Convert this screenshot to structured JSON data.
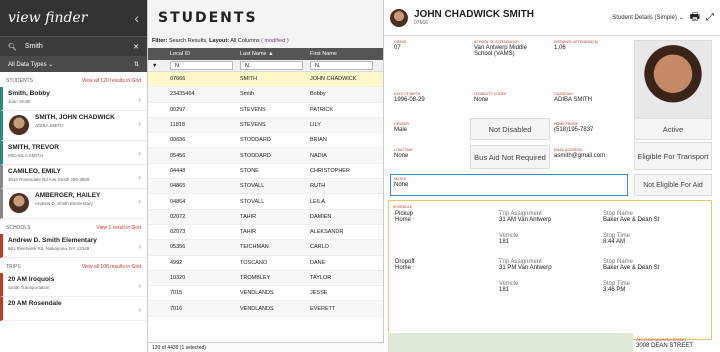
{
  "left": {
    "logo": "view finder",
    "search_value": "Smith",
    "filter_label": "All Data Types",
    "students_header": "STUDENTS",
    "students_link": "View all 120 results in Grid",
    "students": [
      {
        "name": "Smith, Bobby",
        "sub": "Joan Smith"
      },
      {
        "name": "SMITH, JOHN CHADWICK",
        "sub": "ADIBA SMITH"
      },
      {
        "name": "SMITH, TREVOR",
        "sub": "MICAELA SMITH"
      },
      {
        "name": "CAMILEO, EMILY",
        "sub": "3010 Rosendale Rd Ave Smith 280-3609"
      },
      {
        "name": "AMBERGER, HAILEY",
        "sub": "Andrew D. Smith Elementary"
      }
    ],
    "schools_header": "SCHOOLS",
    "schools_link": "View 1 result in Grid",
    "schools": [
      {
        "name": "Andrew D. Smith Elementary",
        "sub": "961 Riverview Rd, Niskayuna, NY 12348"
      }
    ],
    "trips_header": "TRIPS",
    "trips_link": "View all 108 results in Grid",
    "trips": [
      {
        "name": "20 AM Iroquois",
        "sub": "Smith Transportation"
      },
      {
        "name": "20 AM Rosendale",
        "sub": ""
      }
    ]
  },
  "mid": {
    "title": "STUDENTS",
    "filter_prefix": "Filter:",
    "filter_value": "Search Results,",
    "layout_prefix": "Layout:",
    "layout_value": "All Columns",
    "modified": "( modified )",
    "columns": [
      "Local ID",
      "Last Name",
      "First Name"
    ],
    "filter_chip": "N.",
    "rows": [
      [
        "07666",
        "SMITH",
        "JOHN CHADWICK"
      ],
      [
        "23435464",
        "Smith",
        "Bobby"
      ],
      [
        "00297",
        "STEVENS",
        "PATRICK"
      ],
      [
        "11818",
        "STEVENS",
        "LILY"
      ],
      [
        "00636",
        "STODDARD",
        "BRIAN"
      ],
      [
        "05456",
        "STODDARD",
        "NADIA"
      ],
      [
        "04448",
        "STONE",
        "CHRISTOPHER"
      ],
      [
        "04865",
        "STOVALL",
        "RUTH"
      ],
      [
        "04864",
        "STOVALL",
        "LEILA"
      ],
      [
        "02072",
        "TAHIR",
        "DAMIEN"
      ],
      [
        "02073",
        "TAHIR",
        "ALEKSANDR"
      ],
      [
        "05356",
        "TEICHMAN",
        "CARLO"
      ],
      [
        "4992",
        "TOSCANO",
        "DANE"
      ],
      [
        "10320",
        "TROMBLEY",
        "TAYLOR"
      ],
      [
        "7015",
        "VENDLANDS",
        "JESSE"
      ],
      [
        "7016",
        "VENDLANDS",
        "EVERETT"
      ]
    ],
    "footer": "120 of 4439 (1 selected)"
  },
  "right": {
    "name": "JOHN CHADWICK SMITH",
    "id": "07666",
    "view_label": "Student Details (Simple)",
    "fields": {
      "grade_label": "GRADE",
      "grade": "07",
      "school_label": "SCHOOL OF ATTENDANCE",
      "school": "Van Antwerp Middle School (VAMS)",
      "distance_label": "DISTANCE (ATTENDANCE)",
      "distance": "1.06",
      "dob_label": "DATE OF BIRTH",
      "dob": "1996-08-29",
      "disability_label": "DISABILITY CODES",
      "disability": "None",
      "guardian_label": "GUARDIAN",
      "guardian": "ADIBA SMITH",
      "gender_label": "GENDER",
      "gender": "Male",
      "phone_label": "HOME PHONE",
      "phone": "(518)195-7837",
      "load_label": "LOAD TIME",
      "load": "None",
      "email_label": "EMAIL ADDRESS",
      "email": "asmith@gmail.com",
      "notes_label": "NOTES",
      "notes": "None"
    },
    "badges": {
      "not_disabled": "Not Disabled",
      "active": "Active",
      "bus_aid": "Bus Aid Not Required",
      "eligible": "Eligible For Transport",
      "not_eligible": "Not Eligible For Aid"
    },
    "schedule": {
      "label": "SCHEDULE",
      "pickup": {
        "type": "Pickup",
        "from": "Home",
        "trip_label": "Trip Assignment",
        "trip": "31 AM Van Antwerp",
        "vehicle_label": "Vehicle",
        "vehicle": "181",
        "stop_label": "Stop Name",
        "stop": "Baker Ave & Dean St",
        "time_label": "Stop Time",
        "time": "8:44 AM"
      },
      "dropoff": {
        "type": "Dropoff",
        "from": "Home",
        "trip_label": "Trip Assignment",
        "trip": "31 PM Van Antwerp",
        "vehicle_label": "Vehicle",
        "vehicle": "181",
        "stop_label": "Stop Name",
        "stop": "Baker Ave & Dean St",
        "time_label": "Stop Time",
        "time": "3:46 PM"
      }
    },
    "geocode_label": "GEOCODE ADDRESS STREET",
    "geocode": "3008 DEAN STREET"
  }
}
